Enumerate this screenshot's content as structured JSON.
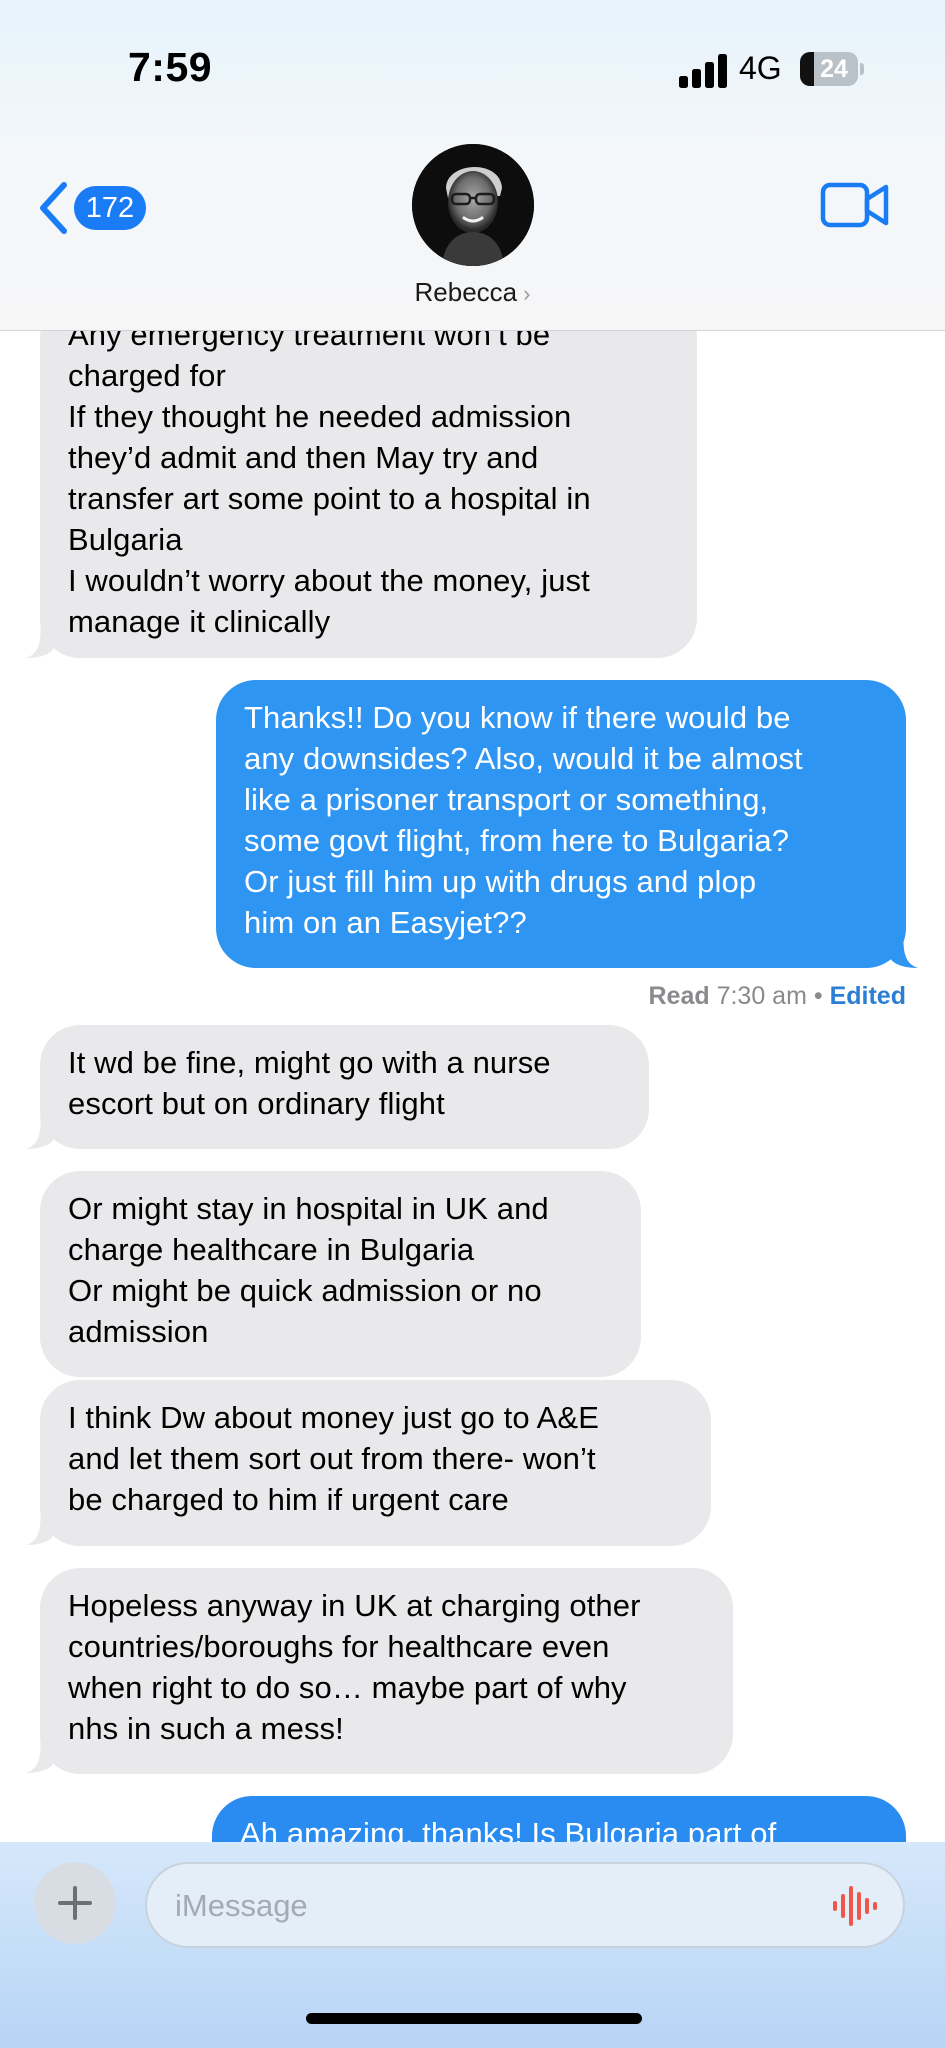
{
  "status_bar": {
    "time": "7:59",
    "network": "4G",
    "battery_level": "24"
  },
  "header": {
    "back_count": "172",
    "contact_name": "Rebecca",
    "icons": {
      "back": "chevron-left-icon",
      "video": "video-camera-icon",
      "disclosure": "chevron-right-icon"
    }
  },
  "messages": [
    {
      "direction": "received",
      "lines": [
        "Any emergency treatment won’t be",
        "charged for",
        "If they thought he needed admission",
        "they’d admit and then May try and",
        "transfer art some point to a hospital in",
        "Bulgaria",
        "I wouldn’t worry about the money, just",
        "manage it clinically"
      ]
    },
    {
      "direction": "sent",
      "lines": [
        "Thanks!! Do you know if there would be",
        "any downsides? Also, would it be almost",
        "like a prisoner transport or something,",
        "some govt flight, from here to Bulgaria?",
        "Or just fill him up with drugs and plop",
        "him on an Easyjet??"
      ]
    },
    {
      "direction": "received",
      "lines": [
        "It wd be fine, might go with a nurse",
        "escort but on ordinary flight"
      ]
    },
    {
      "direction": "received",
      "lines": [
        "Or might stay in hospital in UK and",
        "charge healthcare in Bulgaria",
        "Or might be quick admission or no",
        "admission"
      ]
    },
    {
      "direction": "received",
      "lines": [
        "I think Dw about money just go to A&E",
        "and let them sort out from there- won’t",
        "be charged to him if urgent care"
      ]
    },
    {
      "direction": "received",
      "lines": [
        "Hopeless anyway in UK at charging other",
        "countries/boroughs for healthcare even",
        "when right to do so… maybe part of why",
        "nhs in such a mess!"
      ]
    },
    {
      "direction": "sent",
      "lines": [
        "Ah amazing, thanks! Is Bulgaria part of"
      ]
    }
  ],
  "receipt": {
    "read_label": "Read",
    "time": "7:30 am",
    "separator": "•",
    "edited_label": "Edited"
  },
  "composer": {
    "placeholder": "iMessage",
    "value": "",
    "icons": {
      "plus": "plus-icon",
      "audio": "audio-waveform-icon"
    }
  },
  "colors": {
    "sent_bubble": "#2f95f2",
    "received_bubble": "#e9e9eb",
    "accent": "#1a7cf5",
    "edited": "#2a7fd4",
    "audio_icon": "#f0564a"
  }
}
